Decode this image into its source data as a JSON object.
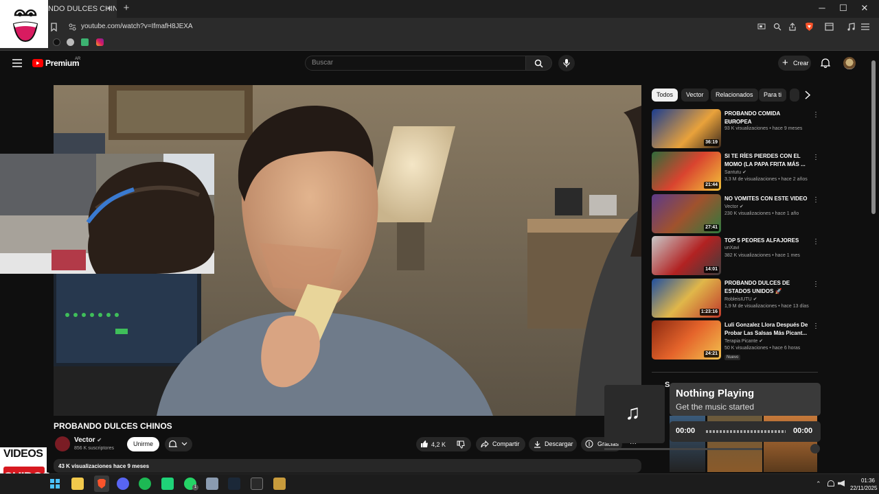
{
  "browser": {
    "tab_title": "NDO DULCES CHINOS",
    "tab_close": "×",
    "new_tab": "+",
    "url": "youtube.com/watch?v=IfmafH8JEXA",
    "window_controls": {
      "minimize": "─",
      "maximize": "☐",
      "close": "✕"
    }
  },
  "header": {
    "logo_text": "Premium",
    "region": "AR",
    "search_placeholder": "Buscar",
    "create_label": "Crear",
    "create_icon": "+"
  },
  "video": {
    "title": "PROBANDO DULCES CHINOS",
    "channel": "Vector",
    "subscribers": "856 K suscriptores",
    "join_label": "Unirme",
    "likes": "4,2 K",
    "share_label": "Compartir",
    "download_label": "Descargar",
    "thanks_label": "Gracias",
    "more_label": "···",
    "views_date": "43 K visualizaciones  hace 9 meses"
  },
  "chips": [
    "Todos",
    "Vector",
    "Relacionados",
    "Para ti"
  ],
  "recommendations": [
    {
      "title": "PROBANDO COMIDA EUROPEA",
      "channel": "Vector",
      "meta": "93 K visualizaciones • hace 9 meses",
      "duration": "36:19"
    },
    {
      "title": "SI TE RÍES PIERDES CON EL MOMO (LA PAPA FRITA MÁS ...",
      "channel": "Santutu",
      "meta": "3,3 M de visualizaciones • hace 2 años",
      "duration": "21:44"
    },
    {
      "title": "NO VOMITES CON ESTE VIDEO",
      "channel": "Vector",
      "meta": "230 K visualizaciones • hace 1 año",
      "duration": "27:41"
    },
    {
      "title": "TOP 5 PEORES ALFAJORES",
      "channel": "unXavi",
      "meta": "382 K visualizaciones • hace 1 mes",
      "duration": "14:01"
    },
    {
      "title": "PROBANDO DULCES DE ESTADOS UNIDOS 🚀",
      "channel": "RobleisIUTU",
      "meta": "1,9 M de visualizaciones • hace 13 días",
      "duration": "1:23:16"
    },
    {
      "title": "Luli Gonzalez Llora Después De Probar Las Salsas Más Picant...",
      "channel": "Terapia Picante",
      "meta": "50 K visualizaciones • hace 6 horas",
      "duration": "24:21",
      "badge": "Nuevo"
    }
  ],
  "shorts_label": "S",
  "music": {
    "title": "Nothing Playing",
    "subtitle": "Get the music started",
    "time_start": "00:00",
    "time_end": "00:00",
    "note_icon": "♫"
  },
  "overlay_logo": {
    "top": "VIDEOS",
    "bottom": "CHIDOS"
  },
  "clock": {
    "time": "01:36",
    "date": "22/11/2025"
  },
  "taskbar_badge": "1"
}
